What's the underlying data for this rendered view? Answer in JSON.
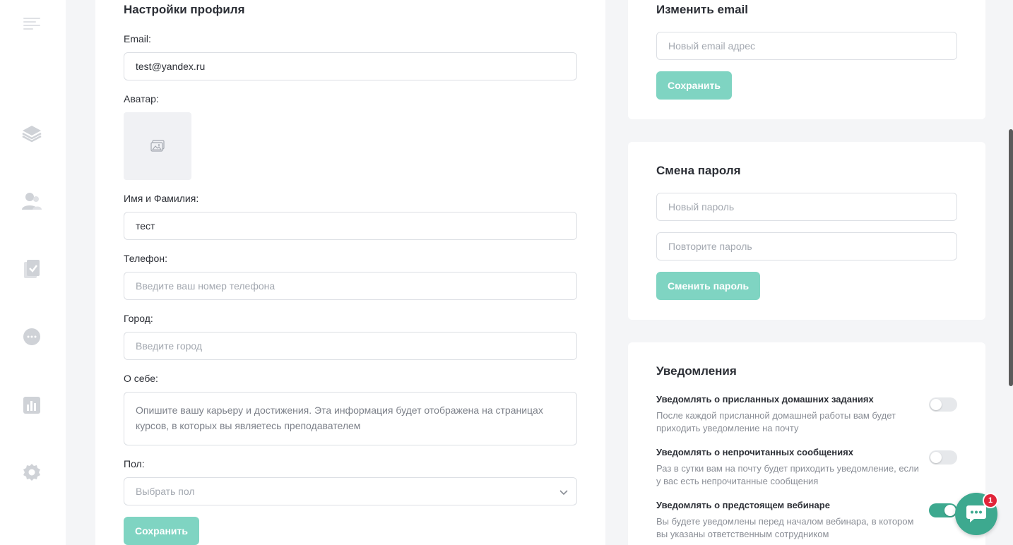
{
  "profile": {
    "title": "Настройки профиля",
    "email_label": "Email:",
    "email_value": "test@yandex.ru",
    "avatar_label": "Аватар:",
    "name_label": "Имя и Фамилия:",
    "name_value": "тест",
    "phone_label": "Телефон:",
    "phone_placeholder": "Введите ваш номер телефона",
    "city_label": "Город:",
    "city_placeholder": "Введите город",
    "about_label": "О себе:",
    "about_placeholder": "Опишите вашу карьеру и достижения. Эта информация будет отображена на страницах курсов, в которых вы являетесь преподавателем",
    "gender_label": "Пол:",
    "gender_placeholder": "Выбрать пол",
    "save_label": "Сохранить"
  },
  "change_email": {
    "title": "Изменить email",
    "new_email_placeholder": "Новый email адрес",
    "save_label": "Сохранить"
  },
  "change_password": {
    "title": "Смена пароля",
    "new_password_placeholder": "Новый пароль",
    "repeat_password_placeholder": "Повторите пароль",
    "submit_label": "Сменить пароль"
  },
  "notifications": {
    "title": "Уведомления",
    "items": [
      {
        "title": "Уведомлять о присланных домашних заданиях",
        "description": "После каждой присланной домашней работы вам будет приходить уведомление на почту",
        "enabled": false
      },
      {
        "title": "Уведомлять о непрочитанных сообщениях",
        "description": "Раз в сутки вам на почту будет приходить уведомление, если у вас есть непрочитанные сообщения",
        "enabled": false
      },
      {
        "title": "Уведомлять о предстоящем вебинаре",
        "description": "Вы будете уведомлены перед началом вебинара, в котором вы указаны ответственным сотрудником",
        "enabled": true
      }
    ]
  },
  "chat": {
    "badge_count": "1"
  },
  "sidebar": {
    "icons": [
      "menu-icon",
      "layers-icon",
      "users-icon",
      "tasks-icon",
      "chat-icon",
      "stats-icon",
      "settings-icon"
    ]
  },
  "colors": {
    "accent": "#3da98f",
    "button": "#7fd4c2",
    "badge": "#e0253a"
  }
}
